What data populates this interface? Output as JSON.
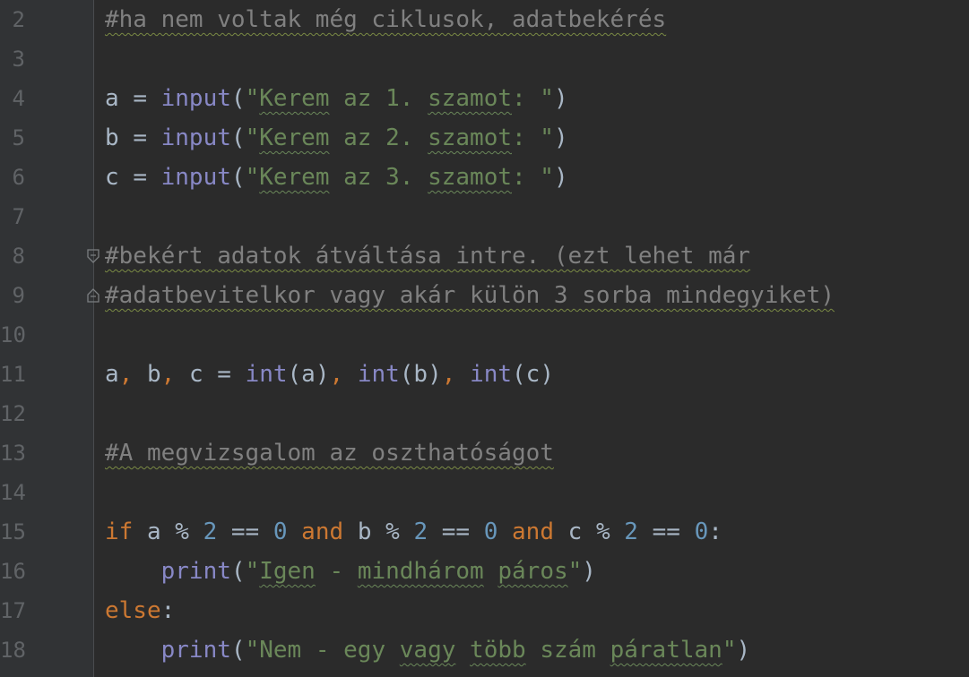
{
  "editor": {
    "language": "python",
    "lines": [
      {
        "n": "2",
        "tokens": [
          {
            "t": "#ha nem voltak még ciklusok, adatbekérés",
            "c": "cmt",
            "s": true
          }
        ]
      },
      {
        "n": "3",
        "tokens": []
      },
      {
        "n": "4",
        "tokens": [
          {
            "t": "a ",
            "c": "op"
          },
          {
            "t": "= ",
            "c": "op"
          },
          {
            "t": "input",
            "c": "builtin"
          },
          {
            "t": "(",
            "c": "op"
          },
          {
            "t": "\"",
            "c": "str"
          },
          {
            "t": "Kerem",
            "c": "str",
            "s": true
          },
          {
            "t": " az 1. ",
            "c": "str"
          },
          {
            "t": "szamot",
            "c": "str",
            "s": true
          },
          {
            "t": ": \"",
            "c": "str"
          },
          {
            "t": ")",
            "c": "op"
          }
        ]
      },
      {
        "n": "5",
        "tokens": [
          {
            "t": "b ",
            "c": "op"
          },
          {
            "t": "= ",
            "c": "op"
          },
          {
            "t": "input",
            "c": "builtin"
          },
          {
            "t": "(",
            "c": "op"
          },
          {
            "t": "\"",
            "c": "str"
          },
          {
            "t": "Kerem",
            "c": "str",
            "s": true
          },
          {
            "t": " az 2. ",
            "c": "str"
          },
          {
            "t": "szamot",
            "c": "str",
            "s": true
          },
          {
            "t": ": \"",
            "c": "str"
          },
          {
            "t": ")",
            "c": "op"
          }
        ]
      },
      {
        "n": "6",
        "tokens": [
          {
            "t": "c ",
            "c": "op"
          },
          {
            "t": "= ",
            "c": "op"
          },
          {
            "t": "input",
            "c": "builtin"
          },
          {
            "t": "(",
            "c": "op"
          },
          {
            "t": "\"",
            "c": "str"
          },
          {
            "t": "Kerem",
            "c": "str",
            "s": true
          },
          {
            "t": " az 3. ",
            "c": "str"
          },
          {
            "t": "szamot",
            "c": "str",
            "s": true
          },
          {
            "t": ": \"",
            "c": "str"
          },
          {
            "t": ")",
            "c": "op"
          }
        ]
      },
      {
        "n": "7",
        "tokens": []
      },
      {
        "n": "8",
        "fold": "start",
        "tokens": [
          {
            "t": "#bekért adatok átváltása intre. (ezt lehet már",
            "c": "cmt",
            "s": true
          }
        ]
      },
      {
        "n": "9",
        "fold": "end",
        "tokens": [
          {
            "t": "#adatbevitelkor vagy akár külön 3 sorba mindegyiket)",
            "c": "cmt",
            "s": true
          }
        ]
      },
      {
        "n": "10",
        "tokens": []
      },
      {
        "n": "11",
        "tokens": [
          {
            "t": "a",
            "c": "op"
          },
          {
            "t": ", ",
            "c": "punc"
          },
          {
            "t": "b",
            "c": "op"
          },
          {
            "t": ", ",
            "c": "punc"
          },
          {
            "t": "c = ",
            "c": "op"
          },
          {
            "t": "int",
            "c": "builtin"
          },
          {
            "t": "(a)",
            "c": "op"
          },
          {
            "t": ", ",
            "c": "punc"
          },
          {
            "t": "int",
            "c": "builtin"
          },
          {
            "t": "(b)",
            "c": "op"
          },
          {
            "t": ", ",
            "c": "punc"
          },
          {
            "t": "int",
            "c": "builtin"
          },
          {
            "t": "(c)",
            "c": "op"
          }
        ]
      },
      {
        "n": "12",
        "tokens": []
      },
      {
        "n": "13",
        "tokens": [
          {
            "t": "#A megvizsgalom az oszthatóságot",
            "c": "cmt",
            "s": true
          }
        ]
      },
      {
        "n": "14",
        "tokens": []
      },
      {
        "n": "15",
        "tokens": [
          {
            "t": "if ",
            "c": "kw"
          },
          {
            "t": "a % ",
            "c": "op"
          },
          {
            "t": "2",
            "c": "num"
          },
          {
            "t": " == ",
            "c": "op"
          },
          {
            "t": "0",
            "c": "num"
          },
          {
            "t": " and ",
            "c": "kw"
          },
          {
            "t": "b % ",
            "c": "op"
          },
          {
            "t": "2",
            "c": "num"
          },
          {
            "t": " == ",
            "c": "op"
          },
          {
            "t": "0",
            "c": "num"
          },
          {
            "t": " and ",
            "c": "kw"
          },
          {
            "t": "c % ",
            "c": "op"
          },
          {
            "t": "2",
            "c": "num"
          },
          {
            "t": " == ",
            "c": "op"
          },
          {
            "t": "0",
            "c": "num"
          },
          {
            "t": ":",
            "c": "op"
          }
        ]
      },
      {
        "n": "16",
        "tokens": [
          {
            "t": "    ",
            "c": "op"
          },
          {
            "t": "print",
            "c": "builtin"
          },
          {
            "t": "(",
            "c": "op"
          },
          {
            "t": "\"",
            "c": "str"
          },
          {
            "t": "Igen",
            "c": "str",
            "s": true
          },
          {
            "t": " - ",
            "c": "str"
          },
          {
            "t": "mindhárom",
            "c": "str",
            "s": true
          },
          {
            "t": " ",
            "c": "str"
          },
          {
            "t": "páros",
            "c": "str",
            "s": true
          },
          {
            "t": "\"",
            "c": "str"
          },
          {
            "t": ")",
            "c": "op"
          }
        ]
      },
      {
        "n": "17",
        "tokens": [
          {
            "t": "else",
            "c": "kw"
          },
          {
            "t": ":",
            "c": "op"
          }
        ]
      },
      {
        "n": "18",
        "tokens": [
          {
            "t": "    ",
            "c": "op"
          },
          {
            "t": "print",
            "c": "builtin"
          },
          {
            "t": "(",
            "c": "op"
          },
          {
            "t": "\"",
            "c": "str"
          },
          {
            "t": "Nem - egy ",
            "c": "str"
          },
          {
            "t": "vagy",
            "c": "str",
            "s": true
          },
          {
            "t": " ",
            "c": "str"
          },
          {
            "t": "több",
            "c": "str",
            "s": true
          },
          {
            "t": " szám ",
            "c": "str"
          },
          {
            "t": "páratlan",
            "c": "str",
            "s": true
          },
          {
            "t": "\"",
            "c": "str"
          },
          {
            "t": ")",
            "c": "op"
          }
        ]
      }
    ]
  },
  "colors": {
    "background": "#2b2b2b",
    "gutter": "#313335",
    "keyword": "#cc7832",
    "builtin": "#8888c6",
    "string": "#6a8759",
    "number": "#6897bb",
    "comment": "#808080",
    "text": "#a9b7c6",
    "line_number": "#606366"
  }
}
